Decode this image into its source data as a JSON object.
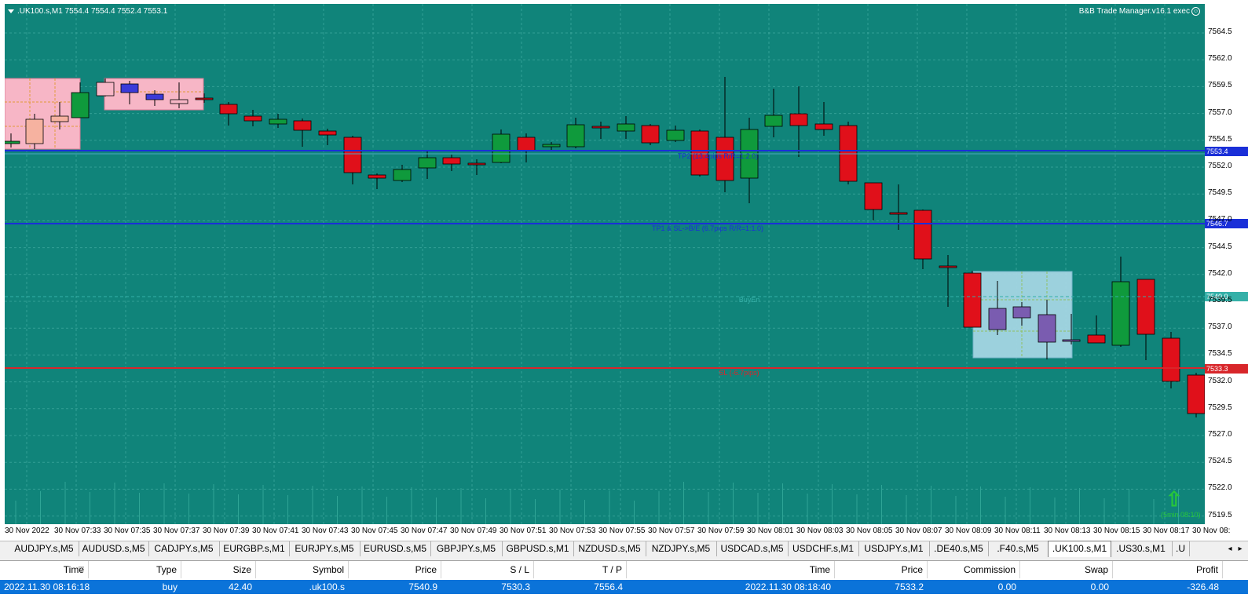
{
  "chart": {
    "symbol_header": ".UK100.s,M1  7554.4 7554.4 7552.4 7553.1",
    "ea_name": "B&B Trade Manager.v16.1 exec",
    "price_axis_ticks": [
      "7564.5",
      "7562.0",
      "7559.5",
      "7557.0",
      "7554.5",
      "7552.0",
      "7549.5",
      "7547.0",
      "7544.5",
      "7542.0",
      "7539.5",
      "7537.0",
      "7534.5",
      "7532.0",
      "7529.5",
      "7527.0",
      "7524.5",
      "7522.0",
      "7519.5"
    ],
    "time_axis_ticks": [
      "30 Nov 2022",
      "30 Nov 07:33",
      "30 Nov 07:35",
      "30 Nov 07:37",
      "30 Nov 07:39",
      "30 Nov 07:41",
      "30 Nov 07:43",
      "30 Nov 07:45",
      "30 Nov 07:47",
      "30 Nov 07:49",
      "30 Nov 07:51",
      "30 Nov 07:53",
      "30 Nov 07:55",
      "30 Nov 07:57",
      "30 Nov 07:59",
      "30 Nov 08:01",
      "30 Nov 08:03",
      "30 Nov 08:05",
      "30 Nov 08:07",
      "30 Nov 08:09",
      "30 Nov 08:11",
      "30 Nov 08:13",
      "30 Nov 08:15",
      "30 Nov 08:17",
      "30 Nov 08:"
    ],
    "levels": {
      "tp2_label": "TP2 (13.4pips R/R=1:2.0)",
      "tp2_price_tag": "7553.4",
      "tp1_label": "TP1 & SL->B/E (6.7pips R/R=1:1.0)",
      "tp1_price_tag": "7546.7",
      "entry_label": "BuyEn",
      "entry_price_tag": "7540.0",
      "sl_label": "SL (-6.7pips)",
      "sl_price_tag": "7533.3"
    },
    "timer_label": "(5min 08:10)",
    "colors": {
      "background": "#10847a",
      "bull_candle": "#0f9a3c",
      "bear_candle": "#e0101a",
      "tp_line": "#1a2fd8",
      "sl_line": "#d8262a"
    },
    "icons": {
      "buy_arrow": "arrow-up-icon",
      "menu": "chevron-down-icon"
    }
  },
  "tabs": {
    "items": [
      "AUDJPY.s,M5",
      "AUDUSD.s,M5",
      "CADJPY.s,M5",
      "EURGBP.s,M1",
      "EURJPY.s,M5",
      "EURUSD.s,M5",
      "GBPJPY.s,M5",
      "GBPUSD.s,M1",
      "NZDUSD.s,M5",
      "NZDJPY.s,M5",
      "USDCAD.s,M5",
      "USDCHF.s,M1",
      "USDJPY.s,M1",
      ".DE40.s,M5",
      ".F40.s,M5",
      ".UK100.s,M1",
      ".US30.s,M1",
      ".U"
    ],
    "active_index": 15
  },
  "trade_table": {
    "headers": [
      "Time",
      "Type",
      "Size",
      "Symbol",
      "Price",
      "S / L",
      "T / P",
      "Time",
      "Price",
      "Commission",
      "Swap",
      "Profit"
    ],
    "rows": [
      [
        "2022.11.30 08:16:18",
        "buy",
        "42.40",
        ".uk100.s",
        "7540.9",
        "7530.3",
        "7556.4",
        "2022.11.30 08:18:40",
        "7533.2",
        "0.00",
        "0.00",
        "-326.48"
      ]
    ]
  }
}
